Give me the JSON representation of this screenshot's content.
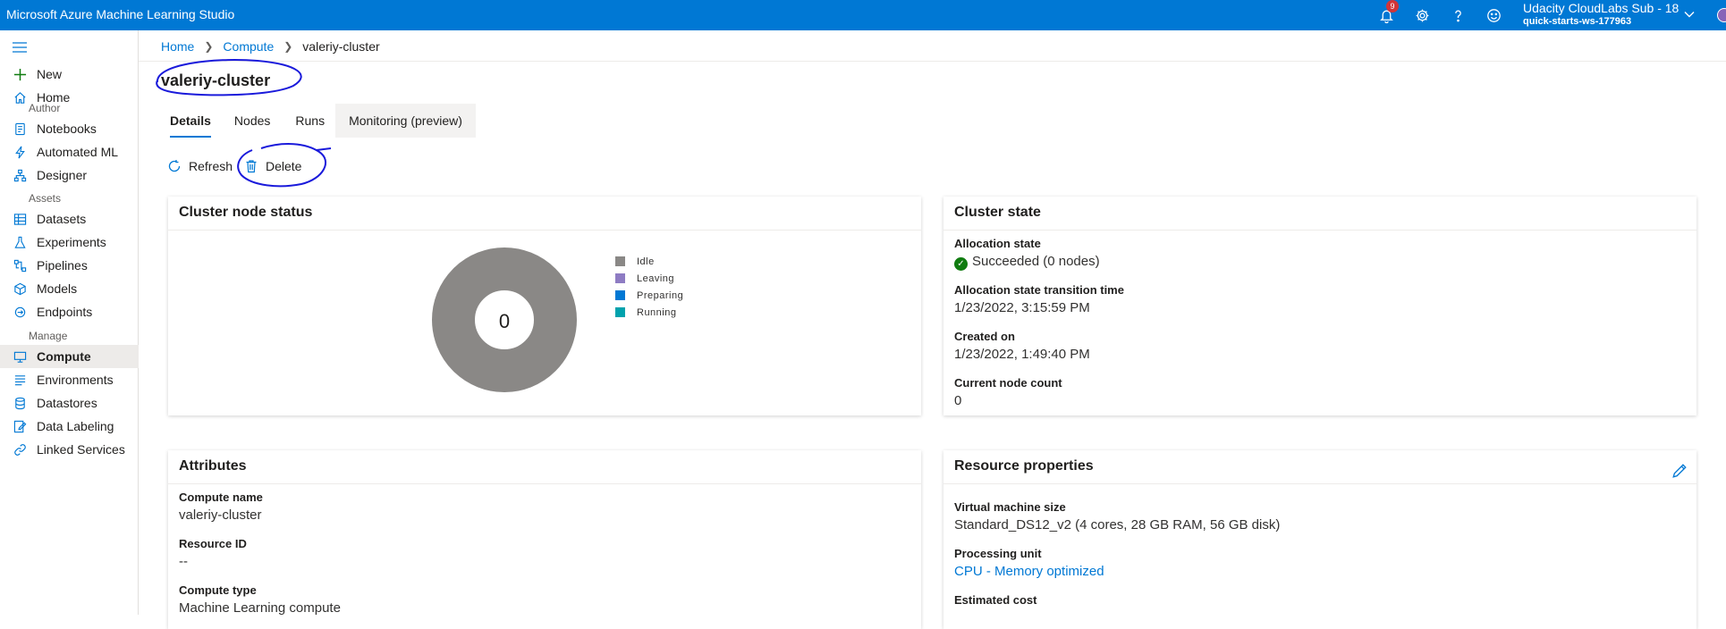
{
  "app": {
    "title": "Microsoft Azure Machine Learning Studio"
  },
  "topbar": {
    "notification_count": "9",
    "account_name": "Udacity CloudLabs Sub - 18",
    "workspace": "quick-starts-ws-177963",
    "icons": [
      "bell-icon",
      "gear-icon",
      "help-icon",
      "feedback-smiley-icon",
      "chevron-down-icon"
    ]
  },
  "sidebar": {
    "new_label": "New",
    "home_label": "Home",
    "sections": {
      "author": "Author",
      "assets": "Assets",
      "manage": "Manage"
    },
    "author_items": [
      "Notebooks",
      "Automated ML",
      "Designer"
    ],
    "assets_items": [
      "Datasets",
      "Experiments",
      "Pipelines",
      "Models",
      "Endpoints"
    ],
    "manage_items": [
      "Compute",
      "Environments",
      "Datastores",
      "Data Labeling",
      "Linked Services"
    ],
    "selected": "Compute"
  },
  "breadcrumb": {
    "home": "Home",
    "compute": "Compute",
    "current": "valeriy-cluster"
  },
  "page": {
    "title": "valeriy-cluster"
  },
  "tabs": [
    "Details",
    "Nodes",
    "Runs",
    "Monitoring (preview)"
  ],
  "commands": {
    "refresh": "Refresh",
    "delete": "Delete"
  },
  "node_status": {
    "title": "Cluster node status",
    "total": "0",
    "legend": [
      {
        "label": "Idle",
        "color": "#8a8886"
      },
      {
        "label": "Leaving",
        "color": "#8e7cc3"
      },
      {
        "label": "Preparing",
        "color": "#0078d4"
      },
      {
        "label": "Running",
        "color": "#00a2ad"
      }
    ]
  },
  "cluster_state": {
    "title": "Cluster state",
    "allocation_state_label": "Allocation state",
    "allocation_state_value": "Succeeded (0 nodes)",
    "transition_label": "Allocation state transition time",
    "transition_value": "1/23/2022, 3:15:59 PM",
    "created_label": "Created on",
    "created_value": "1/23/2022, 1:49:40 PM",
    "node_count_label": "Current node count",
    "node_count_value": "0"
  },
  "attributes": {
    "title": "Attributes",
    "compute_name_label": "Compute name",
    "compute_name_value": "valeriy-cluster",
    "resource_id_label": "Resource ID",
    "resource_id_value": "--",
    "compute_type_label": "Compute type",
    "compute_type_value": "Machine Learning compute"
  },
  "resource_properties": {
    "title": "Resource properties",
    "vm_size_label": "Virtual machine size",
    "vm_size_value": "Standard_DS12_v2 (4 cores, 28 GB RAM, 56 GB disk)",
    "processing_unit_label": "Processing unit",
    "processing_unit_value": "CPU - Memory optimized",
    "estimated_cost_label": "Estimated cost"
  },
  "colors": {
    "accent": "#0078d4",
    "success": "#107c10",
    "badge": "#d13438",
    "annotation_ink": "#1a1adb"
  }
}
